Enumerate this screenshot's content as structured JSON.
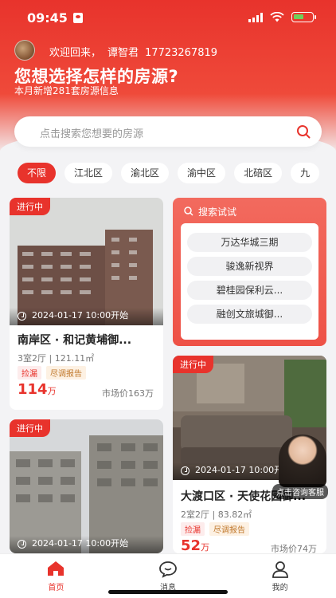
{
  "status_bar": {
    "time": "09:45"
  },
  "header": {
    "welcome": "欢迎回来，",
    "user_name": "谭智君",
    "phone": "17723267819",
    "title": "您想选择怎样的房源?",
    "subtitle": "本月新增281套房源信息"
  },
  "search": {
    "placeholder": "点击搜索您想要的房源"
  },
  "districts": [
    "不限",
    "江北区",
    "渝北区",
    "渝中区",
    "北碚区",
    "九"
  ],
  "search_try": {
    "header": "搜索试试",
    "items": [
      "万达华城三期",
      "骏逸新视界",
      "碧桂园保利云...",
      "融创文旅城御..."
    ]
  },
  "listings": [
    {
      "status": "进行中",
      "time": "2024-01-17 10:00开始",
      "title": "南岸区 · 和记黄埔御...",
      "layout": "3室2厅 | 121.11㎡",
      "tags": [
        "捡漏",
        "尽调报告"
      ],
      "price": "114",
      "price_unit": "万",
      "market": "市场价163万"
    },
    {
      "status": "进行中",
      "time": "2024-01-17 10:00开始",
      "title": "大渡口区 · 天使花园御...",
      "layout": "2室2厅 | 83.82㎡",
      "tags": [
        "捡漏",
        "尽调报告"
      ],
      "price": "52",
      "price_unit": "万",
      "market": "市场价74万"
    },
    {
      "status": "进行中",
      "time": "2024-01-17 10:00开始"
    }
  ],
  "service": {
    "label": "点击咨询客服"
  },
  "tabbar": {
    "home": "首页",
    "messages": "消息",
    "mine": "我的"
  },
  "colors": {
    "brand": "#e8332c"
  }
}
